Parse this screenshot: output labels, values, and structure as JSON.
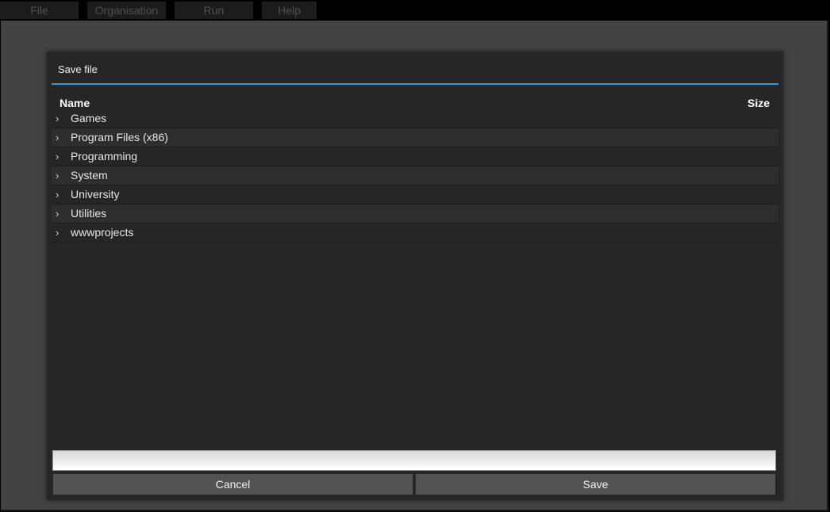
{
  "menu": {
    "items": [
      {
        "label": "File"
      },
      {
        "label": "Organisation"
      },
      {
        "label": "Run"
      },
      {
        "label": "Help"
      }
    ]
  },
  "dialog": {
    "title": "Save file",
    "columns": {
      "name": "Name",
      "size": "Size"
    },
    "entries": [
      {
        "name": "Games"
      },
      {
        "name": "Program Files (x86)"
      },
      {
        "name": "Programming"
      },
      {
        "name": "System"
      },
      {
        "name": "University"
      },
      {
        "name": "Utilities"
      },
      {
        "name": "wwwprojects"
      }
    ],
    "filename": {
      "value": "",
      "placeholder": ""
    },
    "buttons": {
      "cancel": "Cancel",
      "save": "Save"
    }
  },
  "icons": {
    "folder_expand": "chevron-right-icon"
  },
  "colors": {
    "accent": "#2f9ed8",
    "dialog_bg": "#262626",
    "workspace_bg": "#434343"
  }
}
